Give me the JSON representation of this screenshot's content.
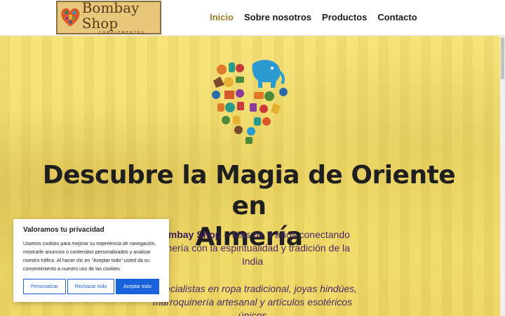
{
  "brand": {
    "logo_title": "Bombay Shop",
    "logo_subtitle": "COMPLEMENTOS"
  },
  "nav": {
    "items": [
      {
        "label": "Inicio",
        "active": true
      },
      {
        "label": "Sobre nosotros",
        "active": false
      },
      {
        "label": "Productos",
        "active": false
      },
      {
        "label": "Contacto",
        "active": false
      }
    ]
  },
  "hero": {
    "headline_line1": "Descubre la Magia de Oriente en",
    "headline_line2": "Almería",
    "intro_brand": "Bombay Shop",
    "intro_rest_line1": " – Más de 9 años conectando",
    "intro_line2": "Almería con la espiritualidad y tradición de la",
    "intro_line3": "India",
    "specialty_line1": "Especialistas en ropa tradicional, joyas hindúes,",
    "specialty_line2": "marroquinería artesanal y artículos esotéricos",
    "specialty_line3": "únicos"
  },
  "cookie": {
    "title": "Valoramos tu privacidad",
    "text_line1": "Usamos cookies para mejorar su experiencia de navegación,",
    "text_line2": "mostrarle anuncios o contenidos personalizados y analizar",
    "text_line3": "nuestro tráfico. Al hacer clic en \"Aceptar todo\" usted da su",
    "text_line4": "consentimiento a nuestro uso de las cookies.",
    "btn_customize": "Personalizar",
    "btn_reject": "Rechazar todo",
    "btn_accept": "Aceptar todo"
  },
  "colors": {
    "accent_nav": "#9a7a2a",
    "cookie_button": "#1863dc",
    "hero_overlay": "#f3df6e"
  },
  "icons": {
    "hero_image": "india-culture-heart-icon",
    "logo_image": "heart-logo-icon"
  }
}
